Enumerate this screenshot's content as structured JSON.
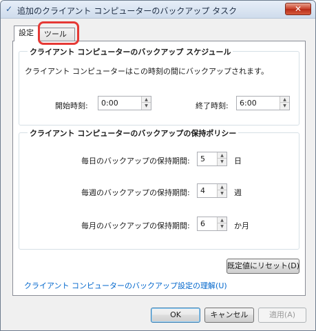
{
  "window": {
    "title": "追加のクライアント コンピューターのバックアップ タスク",
    "close_label": "✕"
  },
  "tabs": [
    {
      "label": "設定",
      "active": true
    },
    {
      "label": "ツール",
      "active": false
    }
  ],
  "schedule": {
    "title": "クライアント コンピューターのバックアップ スケジュール",
    "description": "クライアント コンピューターはこの時刻の間にバックアップされます。",
    "start_label": "開始時刻:",
    "start_value": "0:00",
    "end_label": "終了時刻:",
    "end_value": "6:00"
  },
  "retention": {
    "title": "クライアント コンピューターのバックアップの保持ポリシー",
    "daily_label": "毎日のバックアップの保持期間:",
    "daily_value": "5",
    "daily_unit": "日",
    "weekly_label": "毎週のバックアップの保持期間:",
    "weekly_value": "4",
    "weekly_unit": "週",
    "monthly_label": "毎月のバックアップの保持期間:",
    "monthly_value": "6",
    "monthly_unit": "か月"
  },
  "reset_button": "既定値にリセット(D)",
  "learn_link": "クライアント コンピューターのバックアップ設定の理解(U)",
  "footer": {
    "ok": "OK",
    "cancel": "キャンセル",
    "apply": "適用(A)"
  },
  "colors": {
    "highlight": "#e53935",
    "link": "#0066cc"
  }
}
